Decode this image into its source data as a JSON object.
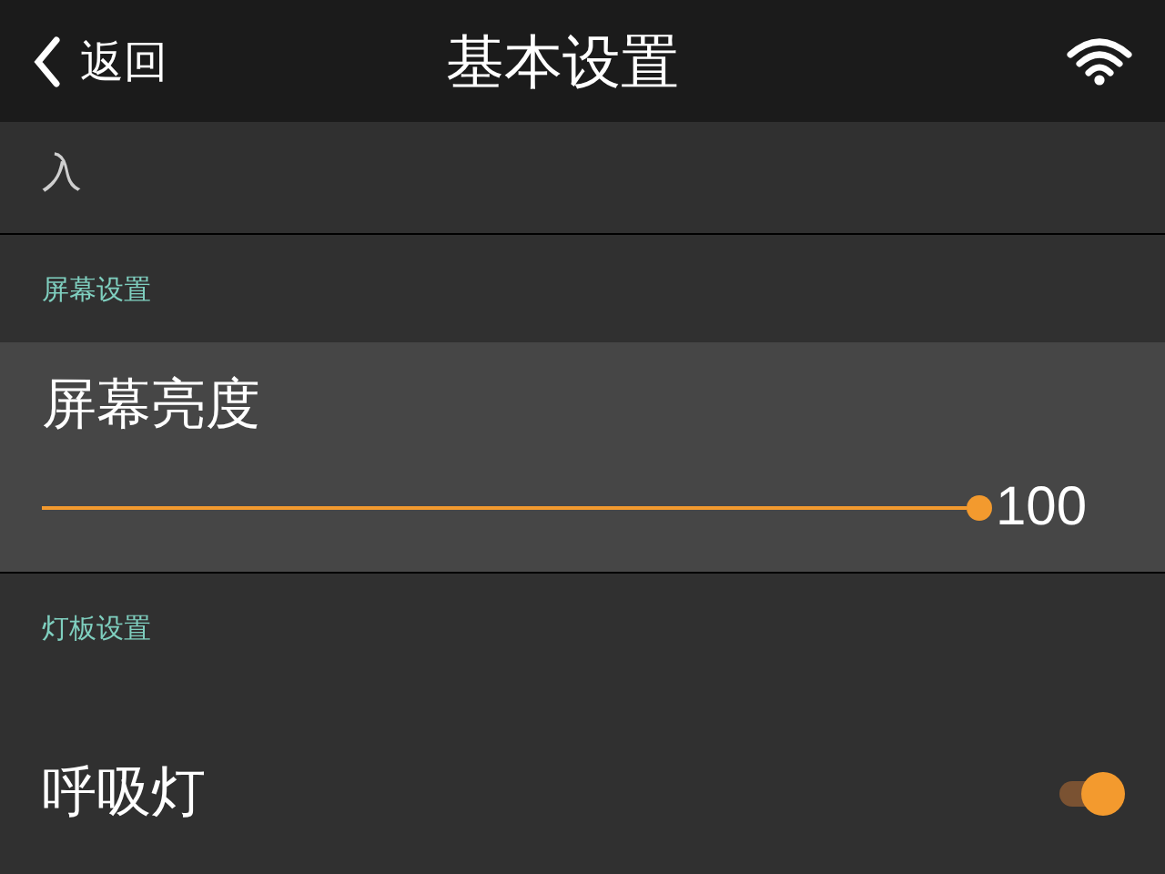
{
  "header": {
    "back_label": "返回",
    "title": "基本设置"
  },
  "intro_text": "入",
  "sections": [
    {
      "label": "屏幕设置",
      "rows": [
        {
          "kind": "slider",
          "title": "屏幕亮度",
          "level": 1.0,
          "reading": "100"
        }
      ]
    },
    {
      "label": "灯板设置",
      "rows": [
        {
          "kind": "toggle",
          "title": "呼吸灯",
          "on": true
        }
      ]
    }
  ]
}
